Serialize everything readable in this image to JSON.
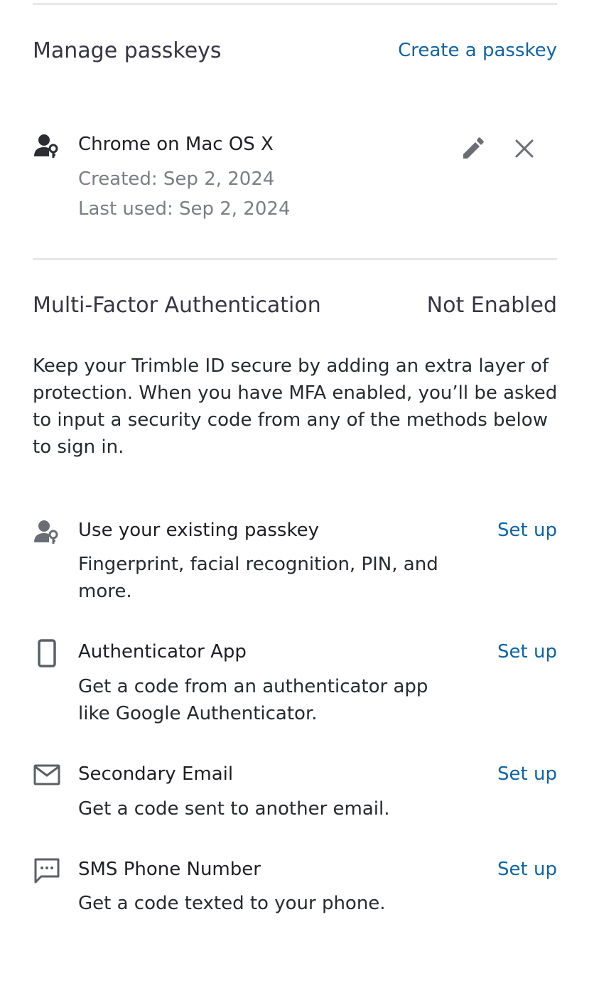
{
  "passkeys": {
    "title": "Manage passkeys",
    "create_label": "Create a passkey",
    "items": [
      {
        "name": "Chrome on Mac OS X",
        "created": "Created: Sep 2, 2024",
        "last_used": "Last used: Sep 2, 2024",
        "icon": "user-key-icon"
      }
    ]
  },
  "mfa": {
    "title": "Multi-Factor Authentication",
    "status": "Not Enabled",
    "description": "Keep your Trimble ID secure by adding an extra layer of protection. When you have MFA enabled, you’ll be asked to input a security code from any of the methods below to sign in.",
    "methods": [
      {
        "title": "Use your existing passkey",
        "subtitle": "Fingerprint, facial recognition, PIN, and more.",
        "action": "Set up",
        "icon": "user-key-icon"
      },
      {
        "title": "Authenticator App",
        "subtitle": "Get a code from an authenticator app like Google Authenticator.",
        "action": "Set up",
        "icon": "smartphone-icon"
      },
      {
        "title": "Secondary Email",
        "subtitle": "Get a code sent to another email.",
        "action": "Set up",
        "icon": "envelope-icon"
      },
      {
        "title": "SMS Phone Number",
        "subtitle": "Get a code texted to your phone.",
        "action": "Set up",
        "icon": "chat-bubble-icon"
      }
    ]
  },
  "colors": {
    "link": "#0e64a8",
    "divider": "#e7e8ea",
    "muted_text": "#7a7e85",
    "icon": "#5a6068"
  }
}
